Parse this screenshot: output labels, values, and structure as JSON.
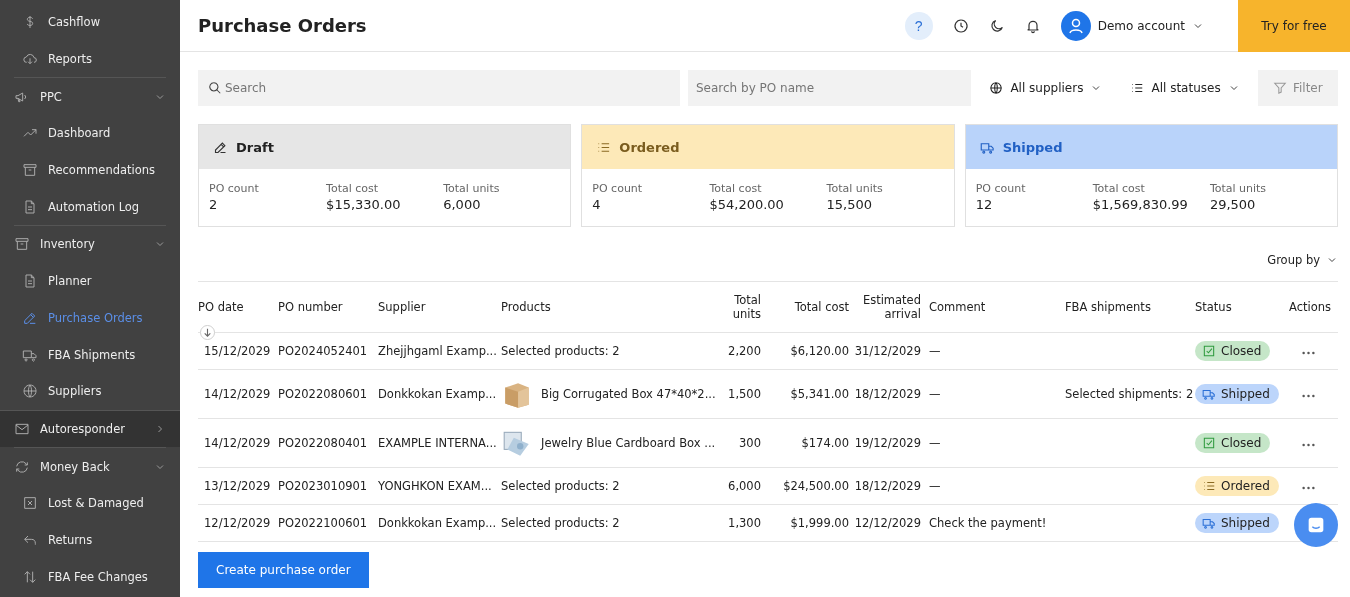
{
  "sidebar": {
    "items": [
      {
        "kind": "link",
        "label": "Cashflow",
        "selected": false
      },
      {
        "kind": "link",
        "label": "Reports",
        "selected": false
      },
      {
        "kind": "group",
        "label": "PPC",
        "expanded": true,
        "hovered": false,
        "children": [
          {
            "label": "Dashboard",
            "selected": false
          },
          {
            "label": "Recommendations",
            "selected": false
          },
          {
            "label": "Automation Log",
            "selected": false
          }
        ]
      },
      {
        "kind": "group",
        "label": "Inventory",
        "expanded": true,
        "hovered": false,
        "children": [
          {
            "label": "Planner",
            "selected": false
          },
          {
            "label": "Purchase Orders",
            "selected": true
          },
          {
            "label": "FBA Shipments",
            "selected": false
          },
          {
            "label": "Suppliers",
            "selected": false
          }
        ]
      },
      {
        "kind": "group",
        "label": "Autoresponder",
        "expanded": false,
        "hovered": true
      },
      {
        "kind": "group",
        "label": "Money Back",
        "expanded": true,
        "hovered": false,
        "children": [
          {
            "label": "Lost & Damaged",
            "selected": false
          },
          {
            "label": "Returns",
            "selected": false
          },
          {
            "label": "FBA Fee Changes",
            "selected": false
          }
        ]
      }
    ]
  },
  "header": {
    "title": "Purchase Orders",
    "help": "?",
    "account": "Demo account",
    "cta": "Try for free"
  },
  "filters": {
    "search_placeholder": "Search",
    "po_name_placeholder": "Search by PO name",
    "suppliers": "All suppliers",
    "statuses": "All statuses",
    "filter": "Filter"
  },
  "summary_cards": [
    {
      "kind": "draft",
      "title": "Draft",
      "stats": [
        {
          "label": "PO count",
          "value": "2"
        },
        {
          "label": "Total cost",
          "value": "$15,330.00"
        },
        {
          "label": "Total units",
          "value": "6,000"
        }
      ]
    },
    {
      "kind": "ordered",
      "title": "Ordered",
      "stats": [
        {
          "label": "PO count",
          "value": "4"
        },
        {
          "label": "Total cost",
          "value": "$54,200.00"
        },
        {
          "label": "Total units",
          "value": "15,500"
        }
      ]
    },
    {
      "kind": "shipped",
      "title": "Shipped",
      "stats": [
        {
          "label": "PO count",
          "value": "12"
        },
        {
          "label": "Total cost",
          "value": "$1,569,830.99"
        },
        {
          "label": "Total units",
          "value": "29,500"
        }
      ]
    }
  ],
  "group_by": "Group by",
  "table": {
    "columns": [
      "PO date",
      "PO number",
      "Supplier",
      "Products",
      "Total units",
      "Total cost",
      "Estimated arrival",
      "Comment",
      "FBA shipments",
      "Status",
      "Actions"
    ],
    "rows": [
      {
        "po_date": "15/12/2029",
        "po_number": "PO2024052401",
        "supplier": "Zhejjhgaml Examp...",
        "products": "Selected products: 2",
        "total_units": "2,200",
        "total_cost": "$6,120.00",
        "estimated_arrival": "31/12/2029",
        "comment": "—",
        "status": {
          "kind": "closed",
          "label": "Closed"
        }
      },
      {
        "po_date": "14/12/2029",
        "po_number": "PO2022080601",
        "supplier": "Donkkokan Examp...",
        "products": "Big Corrugated Box 47*40*2...",
        "total_units": "1,500",
        "total_cost": "$5,341.00",
        "estimated_arrival": "18/12/2029",
        "comment": "—",
        "fba_shipments": "Selected shipments: 2",
        "status": {
          "kind": "shipped",
          "label": "Shipped"
        }
      },
      {
        "po_date": "14/12/2029",
        "po_number": "PO2022080401",
        "supplier": "EXAMPLE INTERNA...",
        "products": "Jewelry Blue Cardboard Box ...",
        "total_units": "300",
        "total_cost": "$174.00",
        "estimated_arrival": "19/12/2029",
        "comment": "—",
        "status": {
          "kind": "closed",
          "label": "Closed"
        }
      },
      {
        "po_date": "13/12/2029",
        "po_number": "PO2023010901",
        "supplier": "YONGHKON EXAM...",
        "products": "Selected products: 2",
        "total_units": "6,000",
        "total_cost": "$24,500.00",
        "estimated_arrival": "18/12/2029",
        "comment": "—",
        "status": {
          "kind": "ordered",
          "label": "Ordered"
        }
      },
      {
        "po_date": "12/12/2029",
        "po_number": "PO2022100601",
        "supplier": "Donkkokan Examp...",
        "products": "Selected products: 2",
        "total_units": "1,300",
        "total_cost": "$1,999.00",
        "estimated_arrival": "12/12/2029",
        "comment": "Check the payment!",
        "status": {
          "kind": "shipped",
          "label": "Shipped"
        }
      }
    ]
  },
  "create_button": "Create purchase order"
}
